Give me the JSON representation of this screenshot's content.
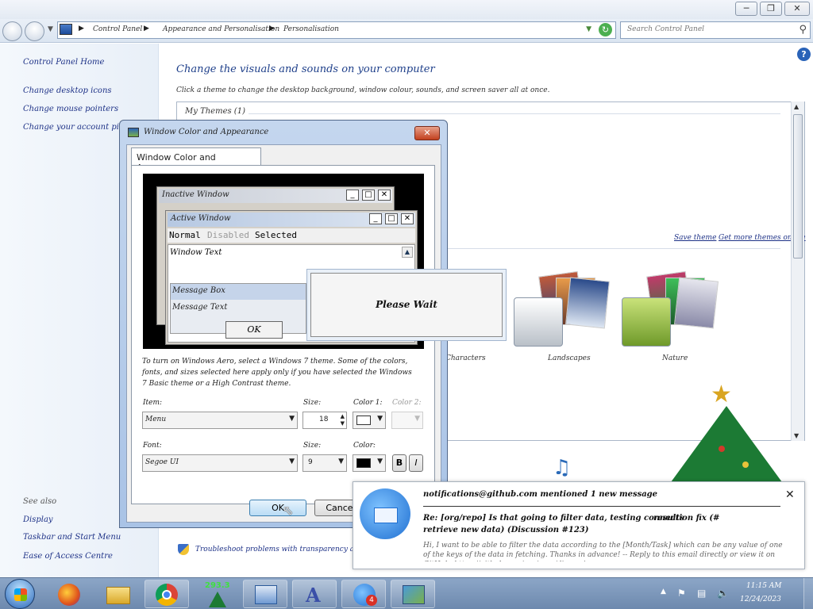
{
  "window": {
    "controls": [
      "─",
      "❐",
      "✕"
    ]
  },
  "address": {
    "breadcrumbs": [
      "Control Panel",
      "Appearance and Personalisation",
      "Personalisation"
    ],
    "search_placeholder": "Search Control Panel"
  },
  "sidebar": {
    "home": "Control Panel Home",
    "links": [
      "Change desktop icons",
      "Change mouse pointers",
      "Change your account picture"
    ],
    "see_also_heading": "See also",
    "see_also": [
      "Display",
      "Taskbar and Start Menu",
      "Ease of Access Centre"
    ]
  },
  "main": {
    "heading": "Change the visuals and sounds on your computer",
    "description": "Click a theme to change the desktop background, window colour, sounds, and screen saver all at once.",
    "my_themes": "My Themes (1)",
    "save_theme": "Save theme",
    "get_more_themes": "Get more themes online",
    "themes": [
      "Characters",
      "Landscapes",
      "Nature"
    ],
    "footer_note": "Troubleshoot problems with transparency and other Aero effects"
  },
  "dialog": {
    "title": "Window Color and Appearance",
    "close": "✕",
    "tab": "Window Color and Appearance",
    "preview": {
      "inactive_title": "Inactive Window",
      "active_title": "Active Window",
      "menu_normal": "Normal",
      "menu_disabled": "Disabled",
      "menu_selected": "Selected",
      "window_text": "Window Text",
      "message_box": "Message Box",
      "message_text": "Message Text",
      "ok": "OK",
      "min": "_",
      "max": "□",
      "close": "✕"
    },
    "instructions": "To turn on Windows Aero, select a Windows 7 theme. Some of the colors, fonts, and sizes selected here apply only if you have selected the Windows 7 Basic theme or a High Contrast theme.",
    "item_label": "Item:",
    "item_value": "Menu",
    "size_label": "Size:",
    "size_value": "18",
    "color1_label": "Color 1:",
    "color2_label": "Color 2:",
    "font_label": "Font:",
    "font_value": "Segoe UI",
    "font_size_label": "Size:",
    "font_size_value": "9",
    "font_color_label": "Color:",
    "bold": "B",
    "italic": "I",
    "ok_button": "OK",
    "cancel_button": "Cancel"
  },
  "wait_popup": {
    "text": "Please Wait"
  },
  "notification": {
    "title": "notifications@github.com mentioned 1 new message",
    "subject": "Re: [org/repo] Is that going to filter data, testing connection fix (#",
    "subject_tail": "results",
    "subject_line2": "retrieve new data) (Discussion #123)",
    "body": "Hi, I want to be able to filter the data according to the [Month/Task] which can be any value of one of the keys of the data in fetching. Thanks in advance! -- Reply to this email directly or view it on GitHub: https://github.com/org/repo/discussions",
    "close": "✕",
    "badge": "4"
  },
  "desktop": {
    "counter": "293.3"
  },
  "taskbar": {
    "clock_time": "11:15 AM",
    "clock_date": "12/24/2023"
  },
  "colors": {
    "link_blue": "#1e3287",
    "heading_blue": "#1e395b",
    "taskbar": "#7a95b8"
  }
}
